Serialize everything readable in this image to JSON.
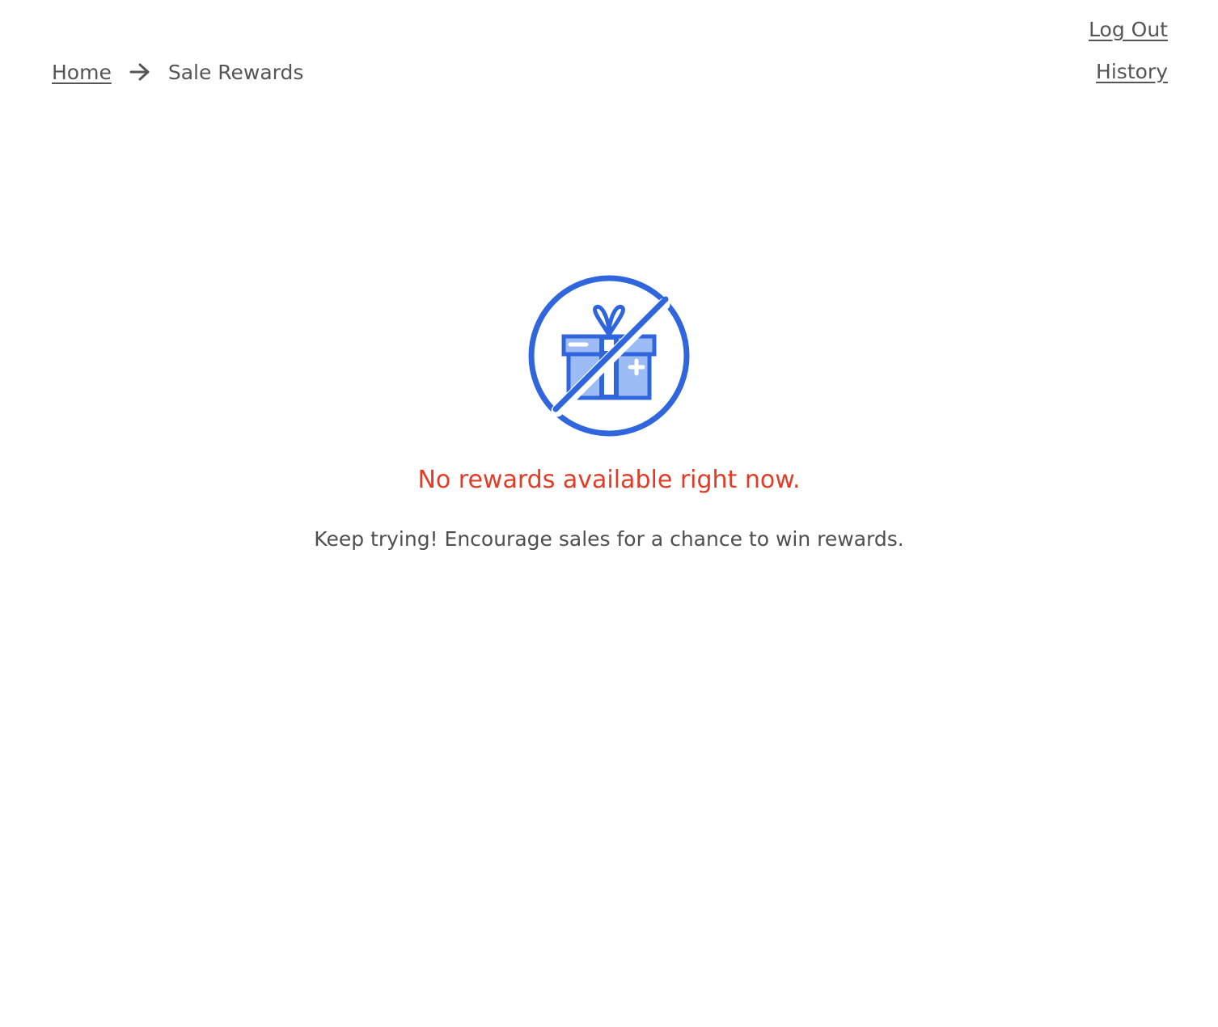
{
  "header": {
    "logout_label": "Log Out",
    "history_label": "History"
  },
  "breadcrumb": {
    "home_label": "Home",
    "separator_icon": "arrow-right-icon",
    "current_label": "Sale Rewards"
  },
  "empty_state": {
    "icon": "no-gift-icon",
    "title": "No rewards available right now.",
    "subtitle": "Keep trying! Encourage sales for a chance to win rewards."
  },
  "colors": {
    "accent_blue": "#2f66dd",
    "light_blue": "#9dbcf6",
    "error_red": "#e33b26",
    "text_gray": "#4f4f4f"
  }
}
